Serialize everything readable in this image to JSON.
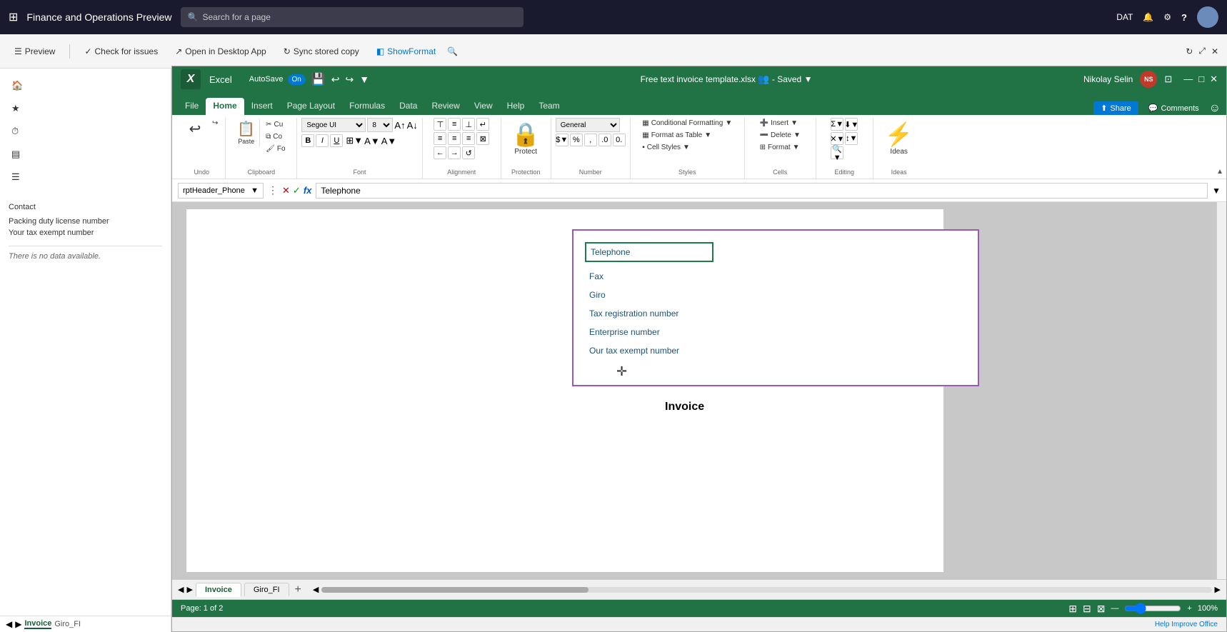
{
  "topnav": {
    "waffle_icon": "⊞",
    "title": "Finance and Operations Preview",
    "search_placeholder": "Search for a page",
    "user_initials": "DAT",
    "icons": {
      "bell": "🔔",
      "gear": "⚙",
      "help": "?",
      "avatar_src": ""
    }
  },
  "appbar": {
    "preview_label": "Preview",
    "check_issues_label": "Check for issues",
    "open_desktop_label": "Open in Desktop App",
    "sync_label": "Sync stored copy",
    "show_format_label": "ShowFormat",
    "search_icon": "🔍"
  },
  "excel": {
    "title": "Free text invoice template.xlsx",
    "app_name": "Excel",
    "saved_label": "Saved",
    "autosave_label": "AutoSave",
    "autosave_state": "On",
    "user_name": "Nikolay Selin",
    "user_initials": "NS",
    "tabs": [
      "File",
      "Home",
      "Insert",
      "Page Layout",
      "Formulas",
      "Data",
      "Review",
      "View",
      "Help",
      "Team"
    ],
    "active_tab": "Home",
    "share_label": "Share",
    "comments_label": "Comments",
    "ribbon": {
      "groups": {
        "undo": {
          "label": "Undo",
          "undo_icon": "↩",
          "redo_icon": "↪"
        },
        "clipboard": {
          "label": "Clipboard",
          "paste_label": "Paste",
          "cut_label": "Cu",
          "copy_label": "Co",
          "format_painter_label": "Fo"
        },
        "font": {
          "label": "Font",
          "font_name": "Segoe UI",
          "font_size": "8",
          "bold": "B",
          "italic": "I",
          "underline": "U"
        },
        "alignment": {
          "label": "Alignment"
        },
        "protection": {
          "label": "Protection",
          "protect_label": "Protect",
          "protect_icon": "🔒"
        },
        "number": {
          "label": "Number",
          "format": "General",
          "dollar": "$",
          "percent": "%"
        },
        "styles": {
          "label": "Styles",
          "conditional_label": "Conditional Formatting",
          "format_table_label": "Format as Table",
          "cell_styles_label": "Cell Styles"
        },
        "cells": {
          "label": "Cells",
          "insert_label": "Insert",
          "delete_label": "Delete",
          "format_label": "Format"
        },
        "editing": {
          "label": "Editing"
        },
        "ideas": {
          "label": "Ideas",
          "ideas_icon": "⚡"
        }
      }
    },
    "formula_bar": {
      "name_box": "rptHeader_Phone",
      "formula_cancel": "✕",
      "formula_confirm": "✓",
      "formula_icon": "fx",
      "formula_value": "Telephone"
    },
    "sheet": {
      "cells": {
        "telephone": "Telephone",
        "fax": "Fax",
        "giro": "Giro",
        "tax_reg": "Tax registration number",
        "enterprise": "Enterprise number",
        "tax_exempt": "Our tax exempt number"
      },
      "invoice_label": "Invoice"
    },
    "sheet_tabs": [
      "Invoice",
      "Giro_FI"
    ],
    "active_sheet": "Invoice",
    "status": {
      "page_info": "Page: 1 of 2",
      "zoom": "100%"
    }
  },
  "sidebar": {
    "items": [
      {
        "icon": "⊞",
        "label": ""
      },
      {
        "icon": "🏠",
        "label": "Home"
      },
      {
        "icon": "★",
        "label": "Favorites"
      },
      {
        "icon": "⏱",
        "label": "Recent"
      },
      {
        "icon": "▤",
        "label": "Workspaces"
      },
      {
        "icon": "☰",
        "label": "Menu"
      }
    ],
    "content": {
      "contact_label": "Contact",
      "packing_label": "Packing duty license number",
      "tax_exempt_label": "Your tax exempt number",
      "no_data": "There is no data available."
    }
  }
}
